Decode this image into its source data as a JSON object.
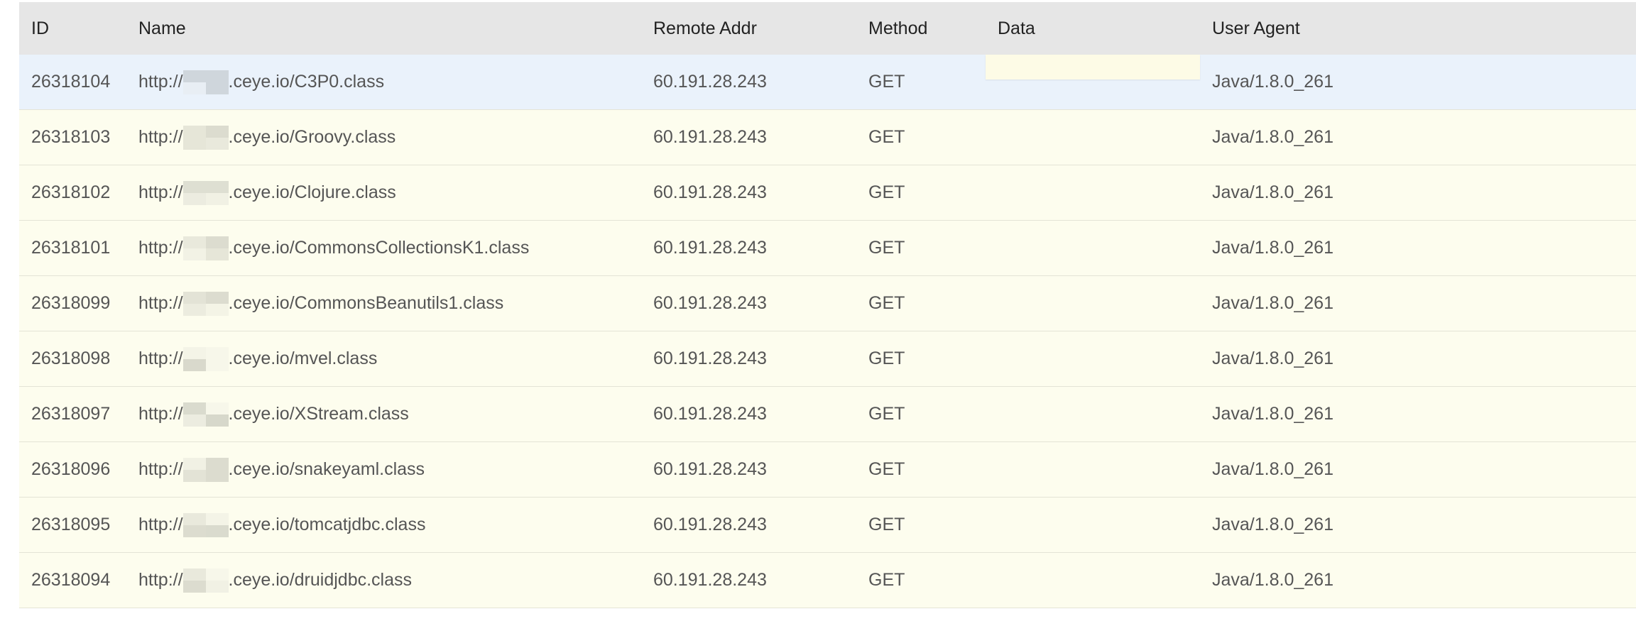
{
  "columns": {
    "id": "ID",
    "name": "Name",
    "remote_addr": "Remote Addr",
    "method": "Method",
    "data": "Data",
    "user_agent": "User Agent"
  },
  "rows": [
    {
      "id": "26318104",
      "name_prefix": "http://",
      "name_suffix": ".ceye.io/C3P0.class",
      "remote_addr": "60.191.28.243",
      "method": "GET",
      "data": "",
      "user_agent": "Java/1.8.0_261"
    },
    {
      "id": "26318103",
      "name_prefix": "http://",
      "name_suffix": ".ceye.io/Groovy.class",
      "remote_addr": "60.191.28.243",
      "method": "GET",
      "data": "",
      "user_agent": "Java/1.8.0_261"
    },
    {
      "id": "26318102",
      "name_prefix": "http://",
      "name_suffix": ".ceye.io/Clojure.class",
      "remote_addr": "60.191.28.243",
      "method": "GET",
      "data": "",
      "user_agent": "Java/1.8.0_261"
    },
    {
      "id": "26318101",
      "name_prefix": "http://",
      "name_suffix": ".ceye.io/CommonsCollectionsK1.class",
      "remote_addr": "60.191.28.243",
      "method": "GET",
      "data": "",
      "user_agent": "Java/1.8.0_261"
    },
    {
      "id": "26318099",
      "name_prefix": "http://",
      "name_suffix": ".ceye.io/CommonsBeanutils1.class",
      "remote_addr": "60.191.28.243",
      "method": "GET",
      "data": "",
      "user_agent": "Java/1.8.0_261"
    },
    {
      "id": "26318098",
      "name_prefix": "http://",
      "name_suffix": ".ceye.io/mvel.class",
      "remote_addr": "60.191.28.243",
      "method": "GET",
      "data": "",
      "user_agent": "Java/1.8.0_261"
    },
    {
      "id": "26318097",
      "name_prefix": "http://",
      "name_suffix": ".ceye.io/XStream.class",
      "remote_addr": "60.191.28.243",
      "method": "GET",
      "data": "",
      "user_agent": "Java/1.8.0_261"
    },
    {
      "id": "26318096",
      "name_prefix": "http://",
      "name_suffix": ".ceye.io/snakeyaml.class",
      "remote_addr": "60.191.28.243",
      "method": "GET",
      "data": "",
      "user_agent": "Java/1.8.0_261"
    },
    {
      "id": "26318095",
      "name_prefix": "http://",
      "name_suffix": ".ceye.io/tomcatjdbc.class",
      "remote_addr": "60.191.28.243",
      "method": "GET",
      "data": "",
      "user_agent": "Java/1.8.0_261"
    },
    {
      "id": "26318094",
      "name_prefix": "http://",
      "name_suffix": ".ceye.io/druidjdbc.class",
      "remote_addr": "60.191.28.243",
      "method": "GET",
      "data": "",
      "user_agent": "Java/1.8.0_261"
    }
  ],
  "mosaics": [
    [
      "#cfd6dc",
      "#cfd6dc",
      "#e8eef4",
      "#cfd6dc"
    ],
    [
      "#e6e6d8",
      "#dcdccf",
      "#e6e6d8",
      "#e9e9dc"
    ],
    [
      "#dedfd2",
      "#dedfd2",
      "#ecece0",
      "#f1f1e4"
    ],
    [
      "#e9e9dc",
      "#dcdccf",
      "#f2f2e5",
      "#e6e6d8"
    ],
    [
      "#e3e3d6",
      "#dcdccf",
      "#ececdf",
      "#f4f4e6"
    ],
    [
      "#f4f4e7",
      "#f7f7ea",
      "#d9d9cc",
      "#f7f7ea"
    ],
    [
      "#dadbce",
      "#f7f7ea",
      "#ecece0",
      "#d7d8cb"
    ],
    [
      "#f1f1e4",
      "#dcdccf",
      "#e3e3d6",
      "#dcdccf"
    ],
    [
      "#e9e9dc",
      "#f4f4e7",
      "#dcdccf",
      "#dadbce"
    ],
    [
      "#e9e9dc",
      "#f7f7ea",
      "#dcdccf",
      "#f1f1e4"
    ]
  ],
  "colors": {
    "header_bg": "#e6e6e6",
    "row_bg": "#fdfdee",
    "row_hover_bg": "#eaf2fb",
    "text": "#555555"
  }
}
